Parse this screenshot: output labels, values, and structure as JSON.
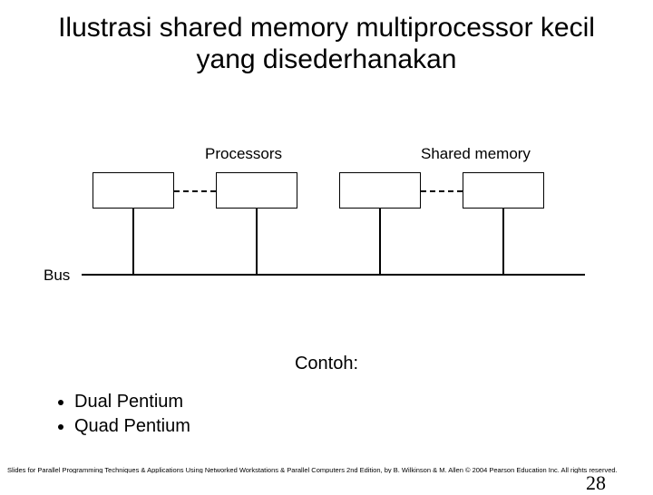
{
  "title": "Ilustrasi shared memory multiprocessor kecil yang disederhanakan",
  "diagram": {
    "processors_label": "Processors",
    "memory_label": "Shared memory",
    "bus_label": "Bus"
  },
  "example_heading": "Contoh:",
  "bullets": {
    "item1": "Dual Pentium",
    "item2": "Quad Pentium"
  },
  "footer": "Slides for Parallel Programming Techniques & Applications Using Networked Workstations & Parallel Computers 2nd Edition, by B. Wilkinson & M. Allen © 2004 Pearson Education Inc. All rights reserved.",
  "page_number": "28"
}
